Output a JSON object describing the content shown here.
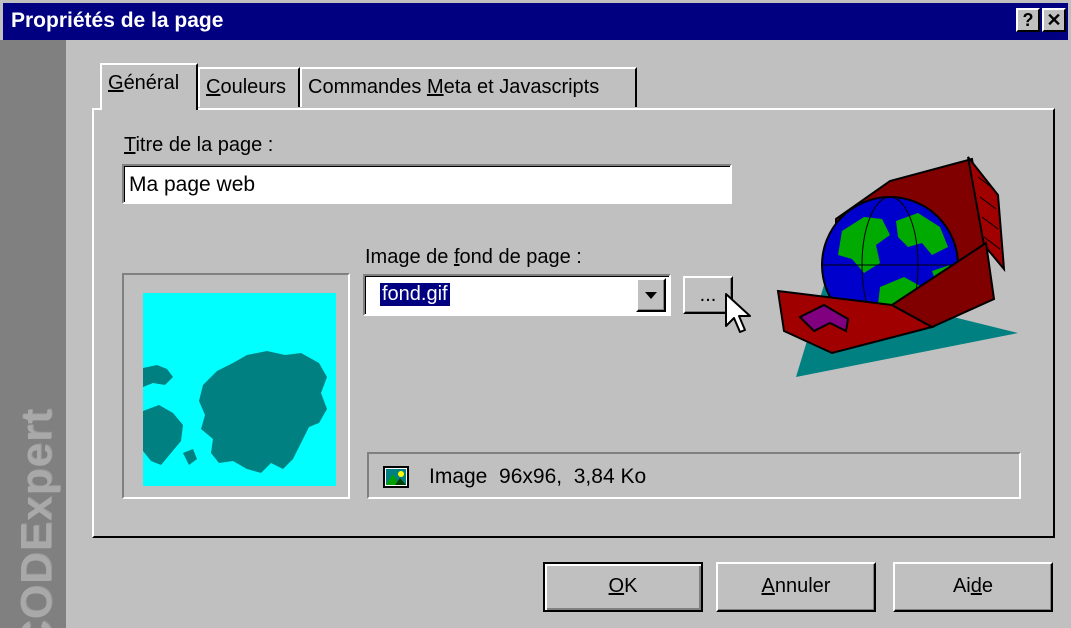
{
  "window": {
    "title": "Propriétés de la page",
    "help_button": "?",
    "close_button": "✕"
  },
  "sidebar": {
    "brand": "CODExpert"
  },
  "tabs": [
    {
      "label": "Général",
      "mnemonic": "G",
      "rest": "énéral",
      "active": true
    },
    {
      "label": "Couleurs",
      "mnemonic": "C",
      "rest": "ouleurs",
      "active": false
    },
    {
      "label": "Commandes Meta et Javascripts",
      "pre": "Commandes ",
      "mnemonic": "M",
      "rest": "eta et Javascripts",
      "active": false
    }
  ],
  "general": {
    "title_label": {
      "mnemonic": "T",
      "rest": "itre de la page :"
    },
    "title_value": "Ma page web",
    "bg_label": {
      "pre": "Image de ",
      "mnemonic": "f",
      "rest": "ond de page :"
    },
    "bg_value": "fond.gif",
    "browse_label": "...",
    "image_info": "Image  96x96,  3,84 Ko"
  },
  "buttons": {
    "ok": {
      "mnemonic": "O",
      "rest": "K"
    },
    "cancel": {
      "mnemonic": "A",
      "rest": "nnuler"
    },
    "help": {
      "pre": "Ai",
      "mnemonic": "d",
      "rest": "e"
    }
  },
  "colors": {
    "title_bar": "#000080",
    "face": "#c0c0c0",
    "preview_bg": "#00ffff",
    "preview_land": "#008080"
  },
  "icons": [
    "help-icon",
    "close-icon",
    "dropdown-arrow-icon",
    "image-file-icon",
    "mouse-cursor-icon",
    "globe-suitcase-illustration"
  ]
}
